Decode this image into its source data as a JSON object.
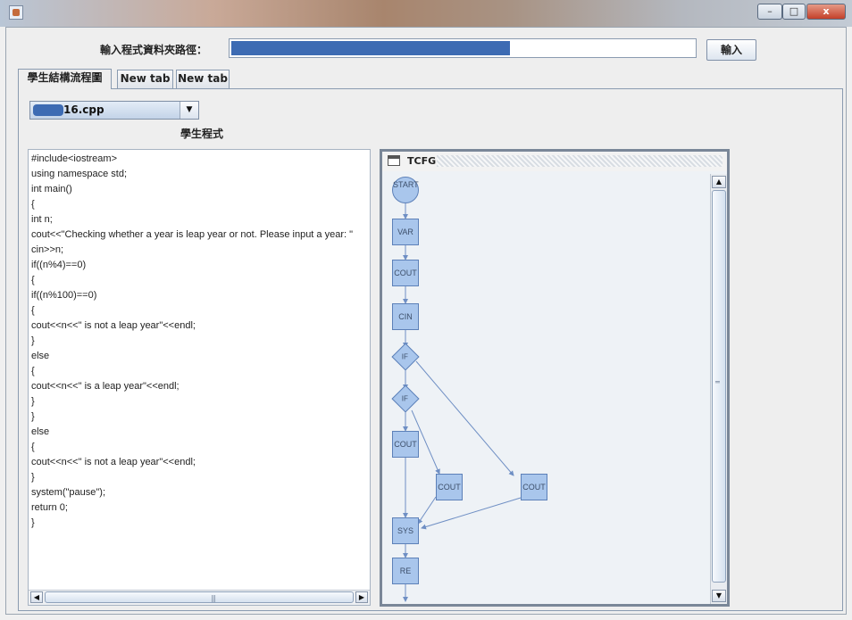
{
  "window": {
    "title": "",
    "controls": {
      "minimize": "–",
      "maximize": "□",
      "close": "x"
    }
  },
  "toolbar": {
    "path_label": "輸入程式資料夾路徑：",
    "path_value": "",
    "input_button": "輸入"
  },
  "tabs": [
    {
      "label": "學生結構流程圖",
      "selected": true
    },
    {
      "label": "New tab",
      "selected": false
    },
    {
      "label": "New tab",
      "selected": false
    }
  ],
  "file_selector": {
    "selected": "16.cpp"
  },
  "code_panel": {
    "title": "學生程式",
    "lines": [
      "#include<iostream>",
      "using namespace std;",
      "int main()",
      "{",
      "int n;",
      "cout<<\"Checking whether a year is leap year or not. Please input a year: \"",
      "cin>>n;",
      "if((n%4)==0)",
      "{",
      "if((n%100)==0)",
      "{",
      "cout<<n<<\" is not a leap year\"<<endl;",
      "}",
      "else",
      "{",
      "cout<<n<<\" is a leap year\"<<endl;",
      "}",
      "}",
      "else",
      "{",
      "cout<<n<<\" is not a leap year\"<<endl;",
      "}",
      "system(\"pause\");",
      "return 0;",
      "}"
    ],
    "hscroll_grip": "|||"
  },
  "graph_panel": {
    "title": "TCFG",
    "nodes": {
      "start": "START",
      "var": "VAR",
      "cout1": "COUT",
      "cin": "CIN",
      "if1": "IF",
      "if2": "IF",
      "cout2": "COUT",
      "cout3": "COUT",
      "cout4": "COUT",
      "sys": "SYS",
      "re": "RE"
    },
    "edge_color": "#6f8fc4"
  },
  "colors": {
    "node_fill": "#a9c6ec",
    "node_border": "#5c80b8",
    "redaction": "#3d6bb3"
  }
}
